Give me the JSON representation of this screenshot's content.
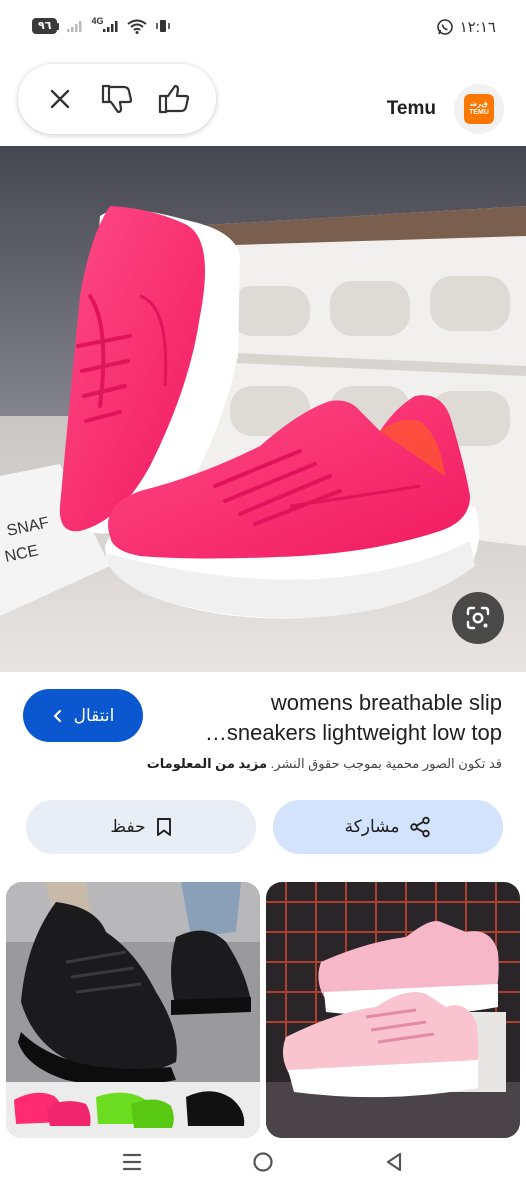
{
  "status_bar": {
    "battery": "٩٦",
    "network": "4G",
    "time": "١٢:١٦"
  },
  "header": {
    "source_name": "Temu",
    "logo_text_top": "ﻕﺮﺷ",
    "logo_text_bottom": "TEMU",
    "icons": [
      "close-icon",
      "thumbs-down-icon",
      "thumbs-up-icon"
    ]
  },
  "result": {
    "title_line1": "womens breathable slip",
    "title_line2": "sneakers lightweight low top…",
    "visit_label": "انتقال",
    "copyright_text": "قد تكون الصور محمية بموجب حقوق النشر.",
    "more_info": "مزيد من المعلومات",
    "share_label": "مشاركة",
    "save_label": "حفظ"
  },
  "colors": {
    "primary": "#0b57d0",
    "share_bg": "#d3e3fd",
    "save_bg": "#e9eef6",
    "brand": "#fb7701",
    "shoe_pink": "#ff2a72"
  }
}
